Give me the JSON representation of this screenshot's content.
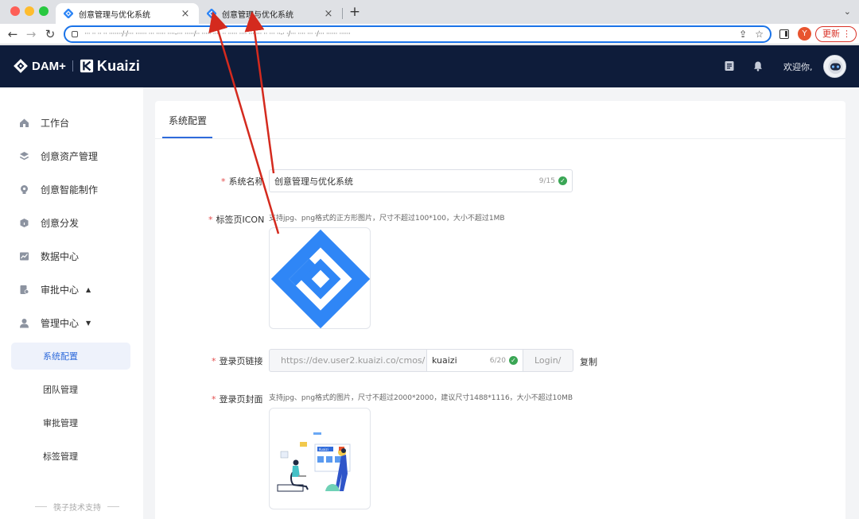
{
  "browser": {
    "tabs": [
      {
        "title": "创意管理与优化系统",
        "close": "×"
      },
      {
        "title": "创意管理与优化系统",
        "close": "×"
      }
    ],
    "new_tab": "+",
    "tab_menu": "⌄",
    "url": "··· ·· ·· ·· ·······/·/··· ······ ··· ····· ····-··· ·····/·· ····· ···· ·· ····· ···· ··· ··· ·· ··· ··-· ·/··· ···· ··· ·/··· ······ ······",
    "back": "←",
    "forward": "→",
    "reload": "↻",
    "share": "⇪",
    "star": "☆",
    "profile_initial": "Y",
    "update_label": "更新",
    "update_more": "⋮"
  },
  "header": {
    "brand_dam": "DAM+",
    "brand_kuaizi": "Kuaizi",
    "welcome": "欢迎你,"
  },
  "sidebar": {
    "items": [
      {
        "label": "工作台",
        "icon": "home-icon"
      },
      {
        "label": "创意资产管理",
        "icon": "layers-icon"
      },
      {
        "label": "创意智能制作",
        "icon": "bulb-icon"
      },
      {
        "label": "创意分发",
        "icon": "cube-icon"
      },
      {
        "label": "数据中心",
        "icon": "chart-icon"
      },
      {
        "label": "审批中心",
        "icon": "approval-icon",
        "caret": "▲"
      },
      {
        "label": "管理中心",
        "icon": "user-icon",
        "caret": "▼"
      }
    ],
    "sub_items": [
      {
        "label": "系统配置",
        "active": true
      },
      {
        "label": "团队管理"
      },
      {
        "label": "审批管理"
      },
      {
        "label": "标签管理"
      }
    ],
    "footer": "筷子技术支持"
  },
  "main": {
    "tab": "系统配置",
    "form": {
      "system_name": {
        "label": "系统名称",
        "value": "创意管理与优化系统",
        "count": "9/15"
      },
      "tab_icon": {
        "label": "标签页ICON",
        "hint": "支持jpg、png格式的正方形图片，尺寸不超过100*100，大小不超过1MB"
      },
      "login_url": {
        "label": "登录页链接",
        "prefix": "https://dev.user2.kuaizi.co/cmos/",
        "value": "kuaizi",
        "count": "6/20",
        "suffix": "Login/",
        "copy": "复制"
      },
      "login_cover": {
        "label": "登录页封面",
        "hint": "支持jpg、png格式的图片，尺寸不超过2000*2000，建议尺寸1488*1116，大小不超过10MB",
        "illustration_brand": "Kuaizi"
      }
    },
    "required_mark": "*",
    "ok_mark": "✓"
  },
  "colors": {
    "header_bg": "#0e1c3a",
    "accent": "#2f6bdb",
    "required": "#e34d4d",
    "success": "#3aa655",
    "annotation": "#d42a1e"
  }
}
